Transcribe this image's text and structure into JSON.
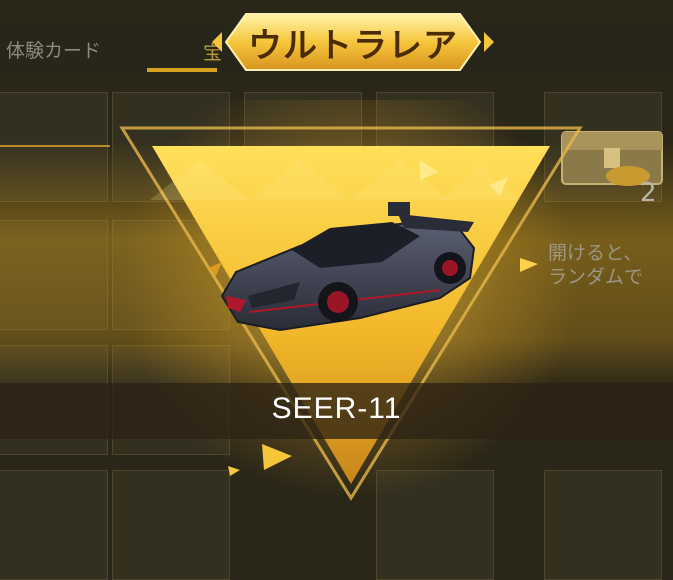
{
  "tabs": {
    "experience_card": "体験カード",
    "second_tab_partial": "宝"
  },
  "reward": {
    "rarity": "ウルトラレア",
    "item_name": "SEER-11"
  },
  "side_panel": {
    "description_line1": "開けると、",
    "description_line2": "ランダムで",
    "chest_count": "2"
  },
  "colors": {
    "gold": "#f5c53a",
    "gold_dark": "#c8901a",
    "banner_text": "#4a2c06",
    "car_body": "#3c3f4e",
    "car_accent": "#b0182a"
  },
  "icons": {
    "car": "sports-car-image",
    "chest": "treasure-chest-icon",
    "arrows": "play-arrow-icon"
  }
}
